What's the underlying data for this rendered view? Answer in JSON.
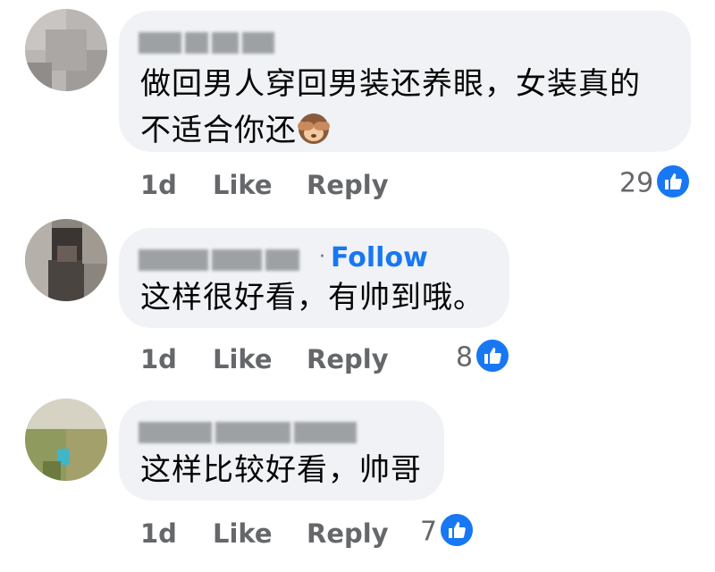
{
  "comments": [
    {
      "text_lines": [
        "做回男人穿回男装还养眼，女装真的",
        "不适合你还"
      ],
      "emoji": "see-no-evil-monkey-icon",
      "time": "1d",
      "like_label": "Like",
      "reply_label": "Reply",
      "reaction_count": "29"
    },
    {
      "follow_dot": "·",
      "follow_label": "Follow",
      "text_lines": [
        "这样很好看，有帅到哦。"
      ],
      "time": "1d",
      "like_label": "Like",
      "reply_label": "Reply",
      "reaction_count": "8"
    },
    {
      "text_lines": [
        "这样比较好看，帅哥"
      ],
      "time": "1d",
      "like_label": "Like",
      "reply_label": "Reply",
      "reaction_count": "7"
    }
  ],
  "colors": {
    "bubble": "#f0f2f5",
    "link": "#1877f2",
    "meta": "#65676b",
    "like_badge": "#1877f2"
  }
}
